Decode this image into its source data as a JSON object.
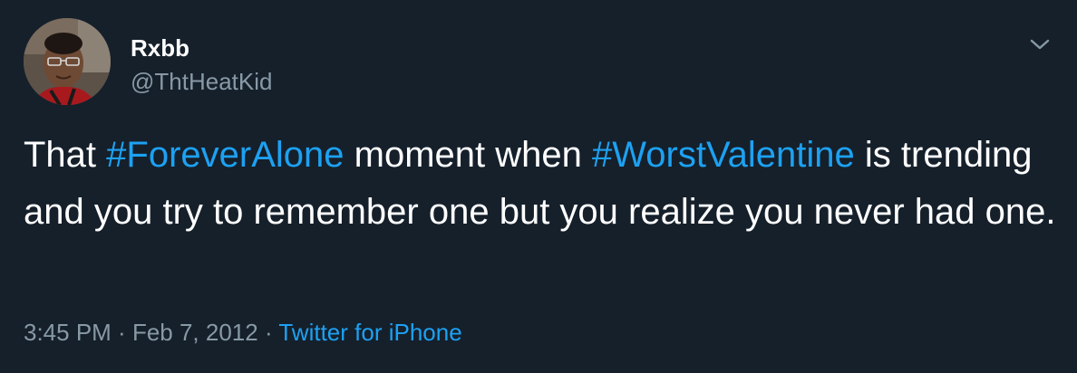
{
  "user": {
    "display_name": "Rxbb",
    "handle": "@ThtHeatKid"
  },
  "tweet": {
    "text_1": "That ",
    "hashtag_1": "#ForeverAlone",
    "text_2": " moment when ",
    "hashtag_2": "#WorstValentine",
    "text_3": " is trending and you try to remember one but you realize you never had one."
  },
  "meta": {
    "time": "3:45 PM",
    "separator_1": " · ",
    "date": "Feb 7, 2012",
    "separator_2": " · ",
    "source": "Twitter for iPhone"
  },
  "icons": {
    "menu": "chevron-down-icon",
    "avatar": "avatar"
  },
  "colors": {
    "background": "#15202b",
    "text": "#ffffff",
    "secondary": "#8899a6",
    "link": "#1da1f2"
  }
}
